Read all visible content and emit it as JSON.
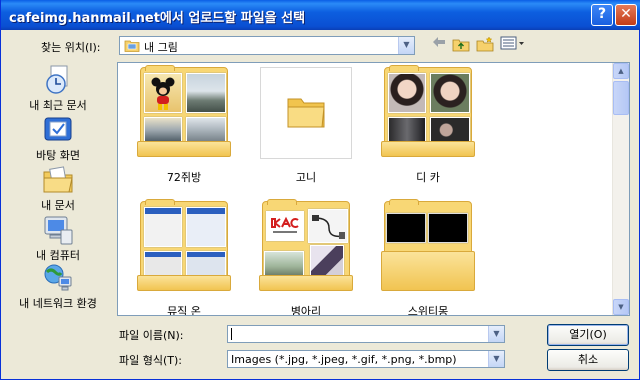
{
  "window": {
    "title": "cafeimg.hanmail.net에서 업로드할 파일을 선택",
    "help_button": "?",
    "close_button": "✕"
  },
  "toolbar": {
    "look_in_label": "찾는 위치(I):",
    "look_in_value": "내 그림",
    "back_icon": "back-arrow-icon",
    "up_icon": "up-folder-icon",
    "new_folder_icon": "new-folder-icon",
    "views_icon": "views-menu-icon"
  },
  "places": [
    {
      "label": "내 최근 문서",
      "icon": "recent-documents-icon"
    },
    {
      "label": "바탕 화면",
      "icon": "desktop-icon"
    },
    {
      "label": "내 문서",
      "icon": "my-documents-icon"
    },
    {
      "label": "내 컴퓨터",
      "icon": "my-computer-icon"
    },
    {
      "label": "내 네트워크 환경",
      "icon": "network-places-icon"
    }
  ],
  "folders": [
    {
      "name": "72쥐방",
      "preview": "photos"
    },
    {
      "name": "고니",
      "preview": "empty-folder"
    },
    {
      "name": "디 카",
      "preview": "portraits"
    },
    {
      "name": "뮤직 온",
      "preview": "screenshots"
    },
    {
      "name": "병아리",
      "preview": "mixed"
    },
    {
      "name": "스위티몽",
      "preview": "dark"
    }
  ],
  "form": {
    "filename_label": "파일 이름(N):",
    "filename_value": "",
    "filetype_label": "파일 형식(T):",
    "filetype_value": "Images (*.jpg, *.jpeg, *.gif, *.png, *.bmp)",
    "open_button": "열기(O)",
    "cancel_button": "취소"
  },
  "colors": {
    "titlebar": "#0a4fd2",
    "dialog_bg": "#ece9d8",
    "folder_yellow": "#f8d775"
  }
}
